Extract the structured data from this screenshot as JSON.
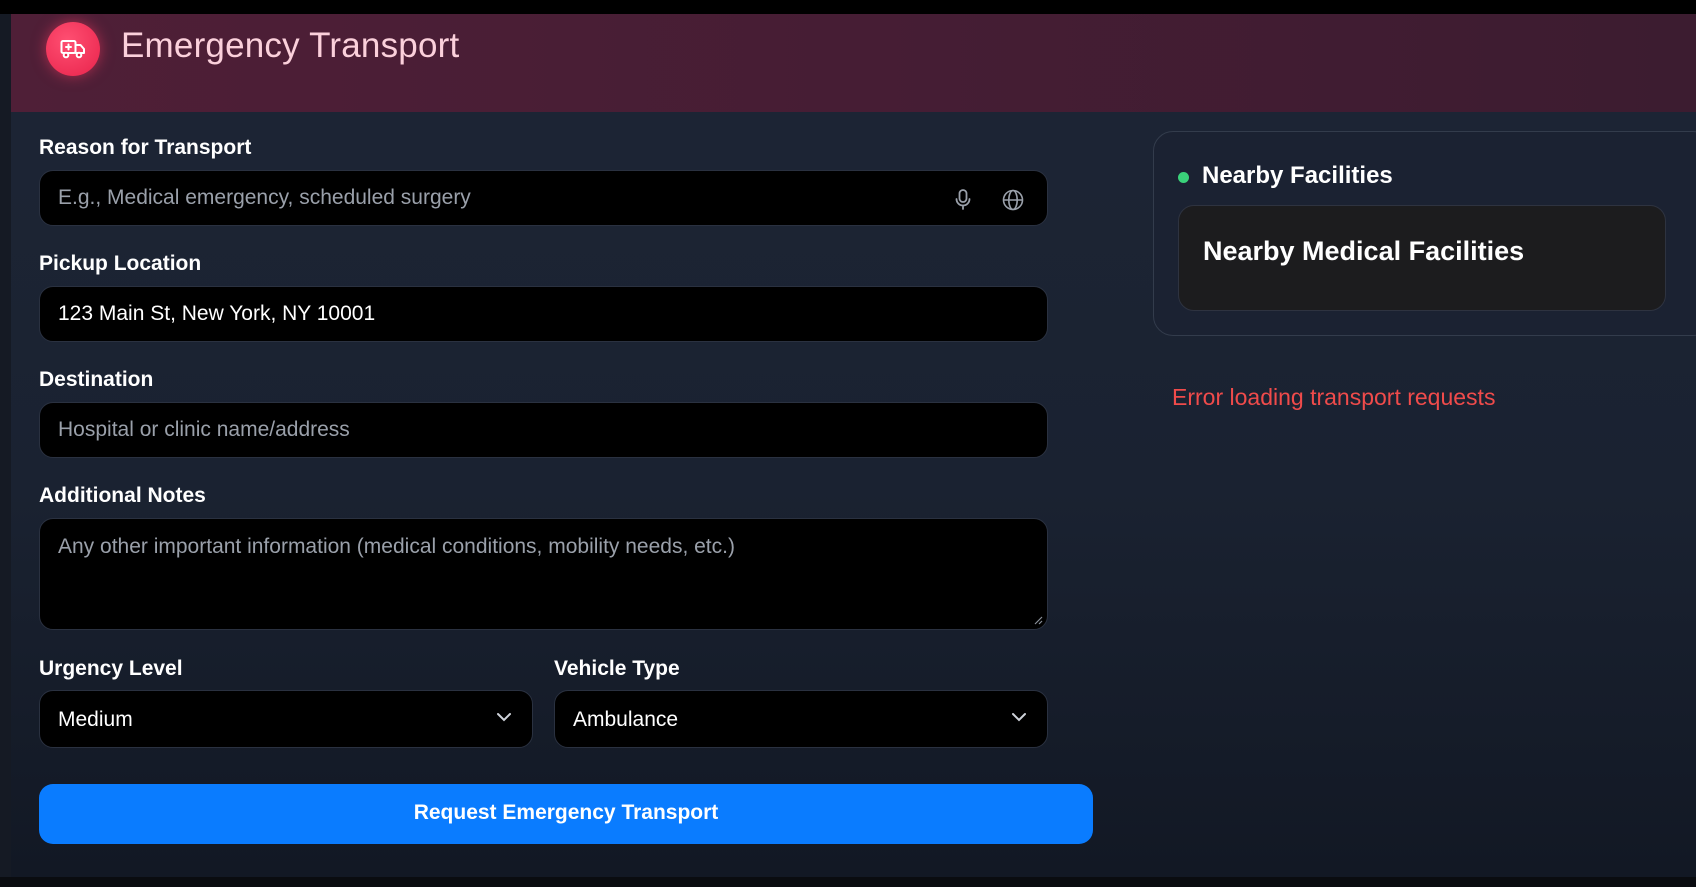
{
  "header": {
    "title": "Emergency Transport",
    "logo_icon": "ambulance-icon"
  },
  "form": {
    "reason": {
      "label": "Reason for Transport",
      "placeholder": "E.g., Medical emergency, scheduled surgery",
      "value": ""
    },
    "pickup": {
      "label": "Pickup Location",
      "value": "123 Main St, New York, NY 10001"
    },
    "destination": {
      "label": "Destination",
      "placeholder": "Hospital or clinic name/address",
      "value": ""
    },
    "notes": {
      "label": "Additional Notes",
      "placeholder": "Any other important information (medical conditions, mobility needs, etc.)"
    },
    "urgency": {
      "label": "Urgency Level",
      "value": "Medium"
    },
    "vehicle": {
      "label": "Vehicle Type",
      "value": "Ambulance"
    },
    "submit_label": "Request Emergency Transport"
  },
  "sidebar": {
    "facilities_title": "Nearby Facilities",
    "facilities_card_title": "Nearby Medical Facilities",
    "error": "Error loading transport requests"
  },
  "colors": {
    "accent": "#0a7cff",
    "logo": "#e8234b",
    "status_dot": "#3ad27a",
    "error": "#f04b4b"
  }
}
